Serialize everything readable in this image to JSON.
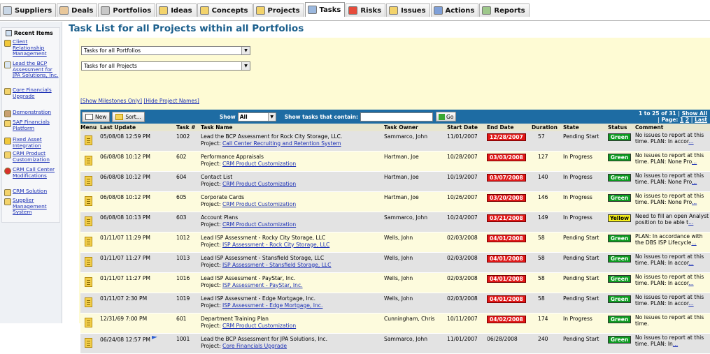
{
  "tabs": [
    {
      "label": "Suppliers",
      "icon": "suppliers-icon",
      "active": false
    },
    {
      "label": "Deals",
      "icon": "deals-icon",
      "active": false
    },
    {
      "label": "Portfolios",
      "icon": "portfolios-icon",
      "active": false
    },
    {
      "label": "Ideas",
      "icon": "ideas-icon",
      "active": false
    },
    {
      "label": "Concepts",
      "icon": "concepts-icon",
      "active": false
    },
    {
      "label": "Projects",
      "icon": "projects-icon",
      "active": false
    },
    {
      "label": "Tasks",
      "icon": "tasks-icon",
      "active": true
    },
    {
      "label": "Risks",
      "icon": "risks-icon",
      "active": false
    },
    {
      "label": "Issues",
      "icon": "issues-icon",
      "active": false
    },
    {
      "label": "Actions",
      "icon": "actions-icon",
      "active": false
    },
    {
      "label": "Reports",
      "icon": "reports-icon",
      "active": false
    }
  ],
  "sidebar": {
    "title": "Recent Items",
    "items": [
      {
        "label": "Client Relationship Management",
        "icon": "lightbulb-icon"
      },
      {
        "label": "Lead the BCP Assessment for JPA Solutions, Inc.",
        "icon": "task-icon"
      },
      {
        "label": "Core Financials Upgrade",
        "icon": "folder-icon"
      },
      {
        "label": "Demonstration",
        "icon": "deal-icon"
      },
      {
        "label": "SAP Financials Platform",
        "icon": "folder-icon"
      },
      {
        "label": "Fixed Asset Integration",
        "icon": "lightbulb-icon"
      },
      {
        "label": "CRM Product Customization",
        "icon": "folder-icon"
      },
      {
        "label": "CRM Call Center Modifications",
        "icon": "risk-icon"
      },
      {
        "label": "CRM Solution",
        "icon": "concept-icon"
      },
      {
        "label": "Supplier Management System",
        "icon": "folder-icon"
      }
    ]
  },
  "main": {
    "title": "Task List for all Projects within all Portfolios",
    "portfolio_select": "Tasks for all Portfolios",
    "project_select": "Tasks for all Projects",
    "show_milestones_link": "[Show Milestones Only]",
    "hide_project_names_link": "[Hide Project Names]",
    "toolbar": {
      "new_label": "New",
      "sort_label": "Sort...",
      "show_label": "Show",
      "show_value": "All",
      "contain_label": "Show tasks that contain:",
      "search_value": "",
      "go_label": "Go",
      "pager_range": "1 to 25 of 31 |",
      "show_all_label": "Show All",
      "page_label": "| Page:",
      "page_1": "1",
      "page_2": "2",
      "last_label": "Last"
    },
    "columns": [
      "Menu",
      "Last Update",
      "Task #",
      "Task Name",
      "Task Owner",
      "Start Date",
      "End Date",
      "Duration",
      "State",
      "Status",
      "Comment"
    ],
    "project_prefix": "Project:",
    "rows": [
      {
        "updated": "05/08/08 12:59 PM",
        "num": "1002",
        "name": "Lead the BCP Assessment for Rock City Storage, LLC.",
        "project": "Call Center Recruiting and Retention System",
        "owner": "Sammarco, John",
        "start": "11/01/2007",
        "end": "12/28/2007",
        "end_overdue": true,
        "duration": "57",
        "state": "Pending Start",
        "status": "Green",
        "comment": "No issues to report at this time. PLAN: In accor",
        "flag": false
      },
      {
        "updated": "06/08/08 10:12 PM",
        "num": "602",
        "name": "Performance Appraisals",
        "project": "CRM Product Customization",
        "owner": "Hartman, Joe",
        "start": "10/28/2007",
        "end": "03/03/2008",
        "end_overdue": true,
        "duration": "127",
        "state": "In Progress",
        "status": "Green",
        "comment": "No issues to report at this time. PLAN: None Pro",
        "flag": false
      },
      {
        "updated": "06/08/08 10:12 PM",
        "num": "604",
        "name": "Contact List",
        "project": "CRM Product Customization",
        "owner": "Hartman, Joe",
        "start": "10/19/2007",
        "end": "03/07/2008",
        "end_overdue": true,
        "duration": "140",
        "state": "In Progress",
        "status": "Green",
        "comment": "No issues to report at this time. PLAN: None Pro",
        "flag": false
      },
      {
        "updated": "06/08/08 10:12 PM",
        "num": "605",
        "name": "Corporate Cards",
        "project": "CRM Product Customization",
        "owner": "Hartman, Joe",
        "start": "10/26/2007",
        "end": "03/20/2008",
        "end_overdue": true,
        "duration": "146",
        "state": "In Progress",
        "status": "Green",
        "comment": "No issues to report at this time. PLAN: None Pro",
        "flag": false
      },
      {
        "updated": "06/08/08 10:13 PM",
        "num": "603",
        "name": "Account Plans",
        "project": "CRM Product Customization",
        "owner": "Sammarco, John",
        "start": "10/24/2007",
        "end": "03/21/2008",
        "end_overdue": true,
        "duration": "149",
        "state": "In Progress",
        "status": "Yellow",
        "comment": "Need to fill an open Analyst position to be able t",
        "flag": false
      },
      {
        "updated": "01/11/07 11:29 PM",
        "num": "1012",
        "name": "Lead ISP Assessment - Rocky City Storage, LLC",
        "project": "ISP Assessment - Rock City Storage, LLC",
        "owner": "Wells, John",
        "start": "02/03/2008",
        "end": "04/01/2008",
        "end_overdue": true,
        "duration": "58",
        "state": "Pending Start",
        "status": "Green",
        "comment": "PLAN: In accordance with the DBS ISP Lifecycle",
        "flag": false
      },
      {
        "updated": "01/11/07 11:27 PM",
        "num": "1013",
        "name": "Lead ISP Assessment - Stansfield Storage, LLC",
        "project": "ISP Assessment - Stansfield Storage, LLC",
        "owner": "Wells, John",
        "start": "02/03/2008",
        "end": "04/01/2008",
        "end_overdue": true,
        "duration": "58",
        "state": "Pending Start",
        "status": "Green",
        "comment": "No issues to report at this time. PLAN: In accor",
        "flag": false
      },
      {
        "updated": "01/11/07 11:27 PM",
        "num": "1016",
        "name": "Lead ISP Assessment - PayStar, Inc.",
        "project": "ISP Assessment - PayStar, Inc.",
        "owner": "Wells, John",
        "start": "02/03/2008",
        "end": "04/01/2008",
        "end_overdue": true,
        "duration": "58",
        "state": "Pending Start",
        "status": "Green",
        "comment": "No issues to report at this time. PLAN: In accor",
        "flag": false
      },
      {
        "updated": "01/11/07 2:30 PM",
        "num": "1019",
        "name": "Lead ISP Assessment - Edge Mortgage, Inc.",
        "project": "ISP Assessment - Edge Mortgage, Inc.",
        "owner": "Wells, John",
        "start": "02/03/2008",
        "end": "04/01/2008",
        "end_overdue": true,
        "duration": "58",
        "state": "Pending Start",
        "status": "Green",
        "comment": "No issues to report at this time. PLAN: In accor",
        "flag": false
      },
      {
        "updated": "12/31/69 7:00 PM",
        "num": "601",
        "name": "Department Training Plan",
        "project": "CRM Product Customization",
        "owner": "Cunningham, Chris",
        "start": "10/11/2007",
        "end": "04/02/2008",
        "end_overdue": true,
        "duration": "174",
        "state": "In Progress",
        "status": "Green",
        "comment": "No issues to report at this time.",
        "flag": false
      },
      {
        "updated": "06/24/08 12:57 PM",
        "num": "1001",
        "name": "Lead the BCP Assessment for JPA Solutions, Inc.",
        "project": "Core Financials Upgrade",
        "owner": "Sammarco, John",
        "start": "11/01/2007",
        "end": "06/28/2008",
        "end_overdue": false,
        "duration": "240",
        "state": "Pending Start",
        "status": "Green",
        "comment": "No issues to report at this time. PLAN: In",
        "flag": true
      }
    ],
    "ellipsis": "..."
  },
  "colors": {
    "accent": "#1e6ca3",
    "title": "#1b5f8c",
    "overdue": "#e01717",
    "status_green": "#0b9a1f",
    "status_yellow": "#f6f01a",
    "panel": "#fefbd4"
  }
}
